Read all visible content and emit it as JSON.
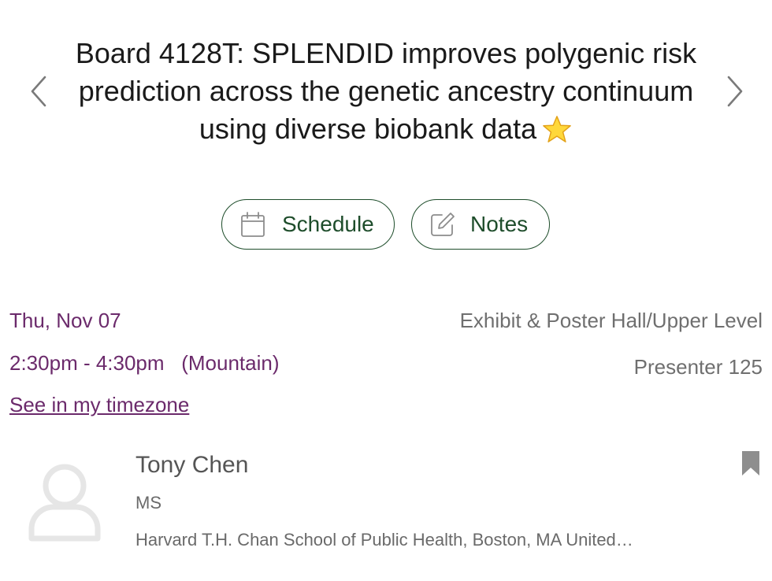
{
  "session": {
    "title": "Board 4128T: SPLENDID improves polygenic risk prediction across the genetic ancestry continuum using diverse biobank data",
    "title_badge_icon": "star-icon"
  },
  "actions": {
    "schedule_label": "Schedule",
    "schedule_icon": "calendar-icon",
    "notes_label": "Notes",
    "notes_icon": "edit-note-icon"
  },
  "when": {
    "date": "Thu, Nov 07",
    "time": "2:30pm - 4:30pm   (Mountain)",
    "timezone_link": "See in my timezone"
  },
  "where": {
    "location": "Exhibit & Poster Hall/Upper Level",
    "presenter_number": "Presenter 125"
  },
  "presenter": {
    "name": "Tony Chen",
    "degree": "MS",
    "affiliation": "Harvard T.H. Chan School of Public Health, Boston, MA United…",
    "avatar_icon": "user-placeholder-icon",
    "bookmark_icon": "bookmark-icon"
  },
  "colors": {
    "accent_green": "#1e4d2b",
    "date_purple": "#6b2a6b",
    "muted_gray": "#6f6f6f"
  }
}
